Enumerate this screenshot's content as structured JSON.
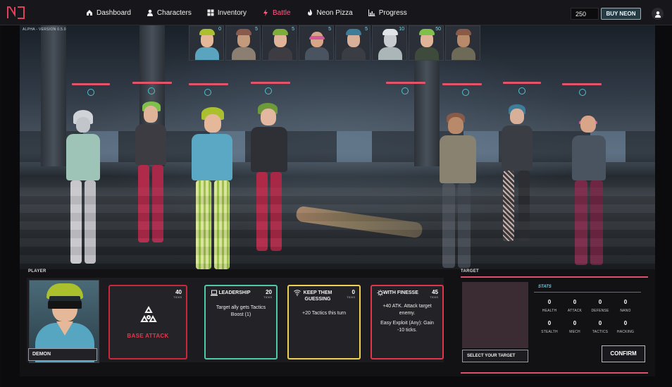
{
  "nav": {
    "items": [
      {
        "label": "Dashboard",
        "icon": "home-icon",
        "active": false
      },
      {
        "label": "Characters",
        "icon": "user-icon",
        "active": false
      },
      {
        "label": "Inventory",
        "icon": "grid-icon",
        "active": false
      },
      {
        "label": "Battle",
        "icon": "lightning-icon",
        "active": true
      },
      {
        "label": "Neon Pizza",
        "icon": "flame-icon",
        "active": false
      },
      {
        "label": "Progress",
        "icon": "bar-chart-icon",
        "active": false
      }
    ],
    "currency_amount": "250",
    "buy_label": "BUY NEON",
    "active_color": "#ff5c86"
  },
  "scene": {
    "version": "ALPHA - VERSION 0.5.0",
    "turn_order": [
      "0",
      "5",
      "5",
      "5",
      "5",
      "10",
      "50",
      ""
    ]
  },
  "player": {
    "section_label": "PLAYER",
    "name": "DEMON",
    "base_attack": {
      "label": "BASE ATTACK",
      "ticks": "40",
      "ticks_label": "TICKS",
      "color": "#d83a48"
    },
    "cards": [
      {
        "title": "LEADERSHIP",
        "ticks": "20",
        "ticks_label": "TICKS",
        "description": "Target ally gets Tactics Boost (1)",
        "border": "#4fc9a8",
        "icon": "laptop-icon"
      },
      {
        "title": "KEEP THEM GUESSING",
        "ticks": "0",
        "ticks_label": "TICKS",
        "description": "+20 Tactics this turn",
        "border": "#f0cf55",
        "icon": "wifi-icon"
      },
      {
        "title": "WITH FINESSE",
        "ticks": "45",
        "ticks_label": "TICKS",
        "description": "+40 ATK. Attack target enemy.",
        "description2": "Easy Exploit (Any): Gain -10 ticks.",
        "border": "#e0354a",
        "icon": "gear-icon"
      }
    ]
  },
  "target": {
    "section_label": "TARGET",
    "select_label": "SELECT YOUR TARGET",
    "stats_title": "STATS",
    "stats": [
      {
        "label": "HEALTH",
        "value": "0"
      },
      {
        "label": "ATTACK",
        "value": "0"
      },
      {
        "label": "DEFENSE",
        "value": "0"
      },
      {
        "label": "NANO",
        "value": "0"
      },
      {
        "label": "STEALTH",
        "value": "0"
      },
      {
        "label": "MECH",
        "value": "0"
      },
      {
        "label": "TACTICS",
        "value": "0"
      },
      {
        "label": "HACKING",
        "value": "0"
      }
    ],
    "confirm_label": "CONFIRM"
  }
}
